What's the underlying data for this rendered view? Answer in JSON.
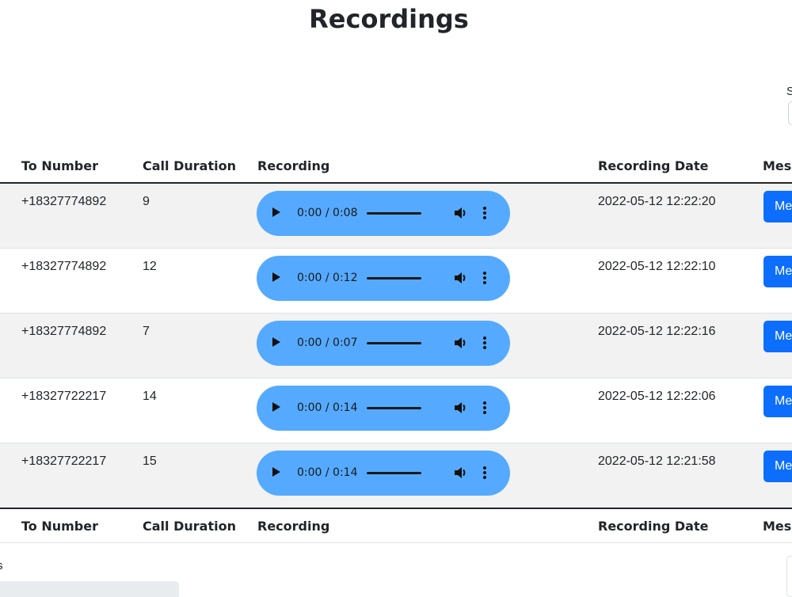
{
  "page": {
    "title": "Recordings"
  },
  "search": {
    "label": "S",
    "value": ""
  },
  "table": {
    "headers": [
      "To Number",
      "Call Duration",
      "Recording",
      "Recording Date",
      "Mess"
    ],
    "rows": [
      {
        "to_number": "+18327774892",
        "duration": "9",
        "audio_time": "0:00 / 0:08",
        "date": "2022-05-12 12:22:20",
        "button": "Me"
      },
      {
        "to_number": "+18327774892",
        "duration": "12",
        "audio_time": "0:00 / 0:12",
        "date": "2022-05-12 12:22:10",
        "button": "Me"
      },
      {
        "to_number": "+18327774892",
        "duration": "7",
        "audio_time": "0:00 / 0:07",
        "date": "2022-05-12 12:22:16",
        "button": "Me"
      },
      {
        "to_number": "+18327722217",
        "duration": "14",
        "audio_time": "0:00 / 0:14",
        "date": "2022-05-12 12:22:06",
        "button": "Me"
      },
      {
        "to_number": "+18327722217",
        "duration": "15",
        "audio_time": "0:00 / 0:14",
        "date": "2022-05-12 12:21:58",
        "button": "Me"
      }
    ]
  },
  "footer": {
    "info": "s"
  },
  "icons": {
    "play": "play-icon",
    "volume": "volume-icon",
    "more": "more-vertical-icon"
  },
  "colors": {
    "audio_bg": "#55aaff",
    "primary": "#0d6efd",
    "stripe": "#f2f2f2"
  }
}
